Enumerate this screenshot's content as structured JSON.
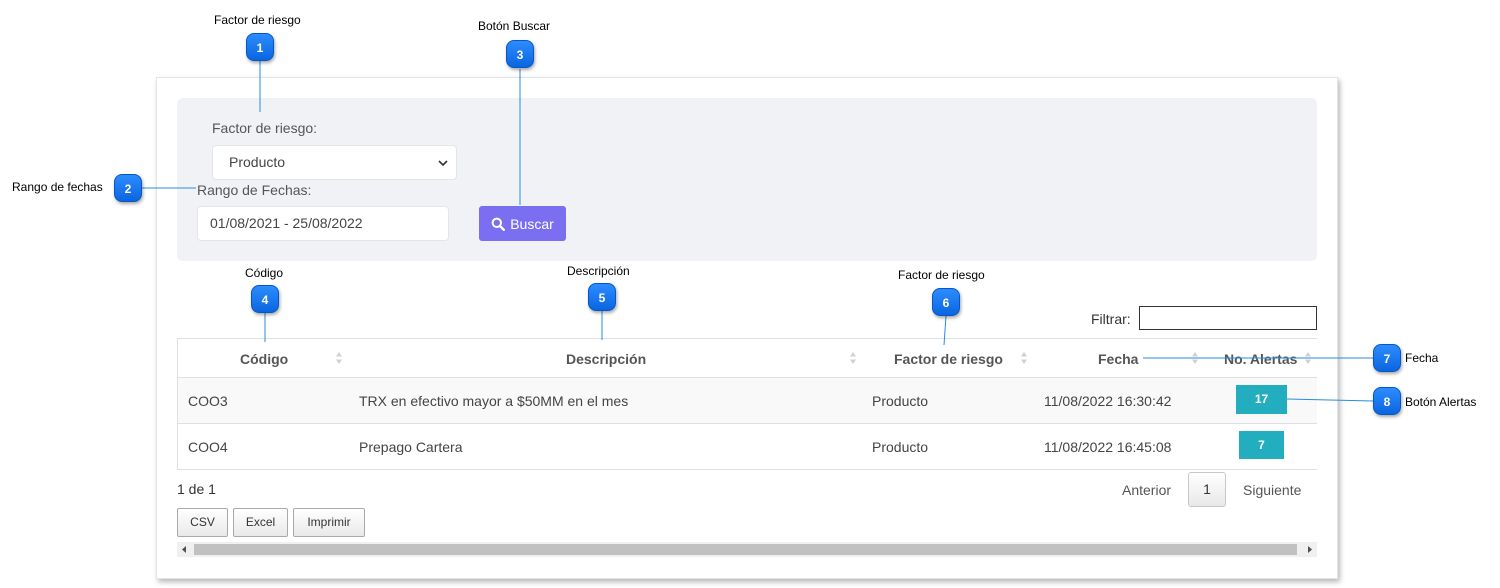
{
  "filters": {
    "factor_label": "Factor de riesgo:",
    "factor_value": "Producto",
    "range_label": "Rango de Fechas:",
    "range_value": "01/08/2021 - 25/08/2022",
    "search_button": "Buscar"
  },
  "filter_box": {
    "label": "Filtrar:"
  },
  "table": {
    "headers": [
      "Código",
      "Descripción",
      "Factor de riesgo",
      "Fecha",
      "No. Alertas"
    ],
    "rows": [
      {
        "codigo": "COO3",
        "descripcion": "TRX en efectivo mayor a $50MM en el mes",
        "factor": "Producto",
        "fecha": "11/08/2022 16:30:42",
        "alertas": "17"
      },
      {
        "codigo": "COO4",
        "descripcion": "Prepago Cartera",
        "factor": "Producto",
        "fecha": "11/08/2022 16:45:08",
        "alertas": "7"
      }
    ]
  },
  "pagination": {
    "info": "1 de 1",
    "prev": "Anterior",
    "page": "1",
    "next": "Siguiente"
  },
  "export": {
    "csv": "CSV",
    "excel": "Excel",
    "print": "Imprimir"
  },
  "annotations": [
    {
      "num": "1",
      "text": "Factor de riesgo"
    },
    {
      "num": "2",
      "text": "Rango de fechas"
    },
    {
      "num": "3",
      "text": "Botón  Buscar"
    },
    {
      "num": "4",
      "text": "Código"
    },
    {
      "num": "5",
      "text": "Descripción"
    },
    {
      "num": "6",
      "text": "Factor de riesgo"
    },
    {
      "num": "7",
      "text": "Fecha"
    },
    {
      "num": "8",
      "text": "Botón Alertas"
    }
  ],
  "colors": {
    "accent": "#7a6ff0",
    "badge": "#22aebf",
    "marker": "#0a66e0"
  },
  "icons": [
    "search-icon",
    "chevron-down-icon",
    "sort-icon",
    "scroll-left-arrow-icon",
    "scroll-right-arrow-icon"
  ]
}
